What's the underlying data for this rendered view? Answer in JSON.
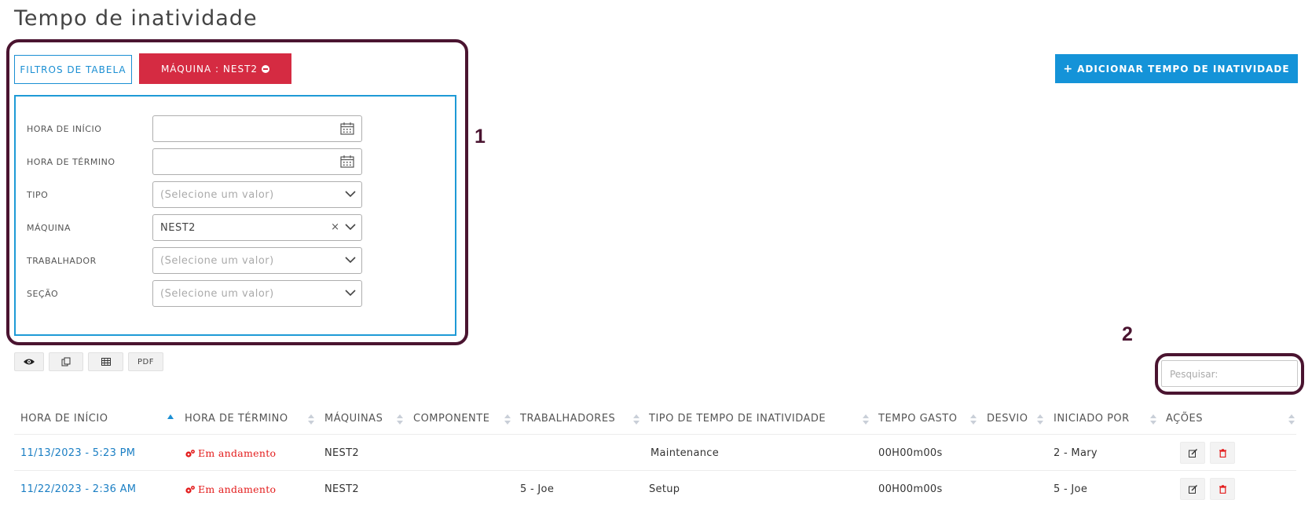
{
  "page": {
    "title": "Tempo de inatividade"
  },
  "annotations": {
    "label_1": "1",
    "label_2": "2"
  },
  "toolbar": {
    "filters_button": "FILTROS DE TABELA",
    "machine_chip": "MÁQUINA : NEST2",
    "add_button": "ADICIONAR TEMPO DE INATIVIDADE"
  },
  "filters": {
    "start_time": {
      "label": "HORA DE INÍCIO",
      "value": ""
    },
    "end_time": {
      "label": "HORA DE TÉRMINO",
      "value": ""
    },
    "type": {
      "label": "TIPO",
      "placeholder": "(Selecione um valor)"
    },
    "machine": {
      "label": "MÁQUINA",
      "value": "NEST2"
    },
    "worker": {
      "label": "TRABALHADOR",
      "placeholder": "(Selecione um valor)"
    },
    "section": {
      "label": "SEÇÃO",
      "placeholder": "(Selecione um valor)"
    }
  },
  "export_buttons": {
    "pdf": "PDF"
  },
  "search": {
    "placeholder": "Pesquisar:"
  },
  "table": {
    "columns": [
      "HORA DE INÍCIO",
      "HORA DE TÉRMINO",
      "MÁQUINAS",
      "COMPONENTE",
      "TRABALHADORES",
      "TIPO DE TEMPO DE INATIVIDADE",
      "TEMPO GASTO",
      "DESVIO",
      "INICIADO POR",
      "AÇÕES"
    ],
    "rows": [
      {
        "start": "11/13/2023 - 5:23 PM",
        "end": "Em andamento",
        "machine": "NEST2",
        "component": "",
        "workers": "",
        "type": "Maintenance",
        "time_spent": "00H00m00s",
        "deviation": "",
        "started_by": "2 - Mary"
      },
      {
        "start": "11/22/2023 - 2:36 AM",
        "end": "Em andamento",
        "machine": "NEST2",
        "component": "",
        "workers": "5 - Joe",
        "type": "Setup",
        "time_spent": "00H00m00s",
        "deviation": "",
        "started_by": "5 - Joe"
      }
    ]
  },
  "colors": {
    "accent_blue": "#1493d8",
    "chip_red": "#d52b42",
    "status_red": "#e31b1b",
    "annotation": "#4a1430"
  },
  "icons": [
    "calendar-icon",
    "chevron-down-icon",
    "clear-icon",
    "minus-circle-icon",
    "plus-icon",
    "eye-icon",
    "copy-icon",
    "table-icon",
    "gears-icon",
    "edit-icon",
    "trash-icon"
  ]
}
